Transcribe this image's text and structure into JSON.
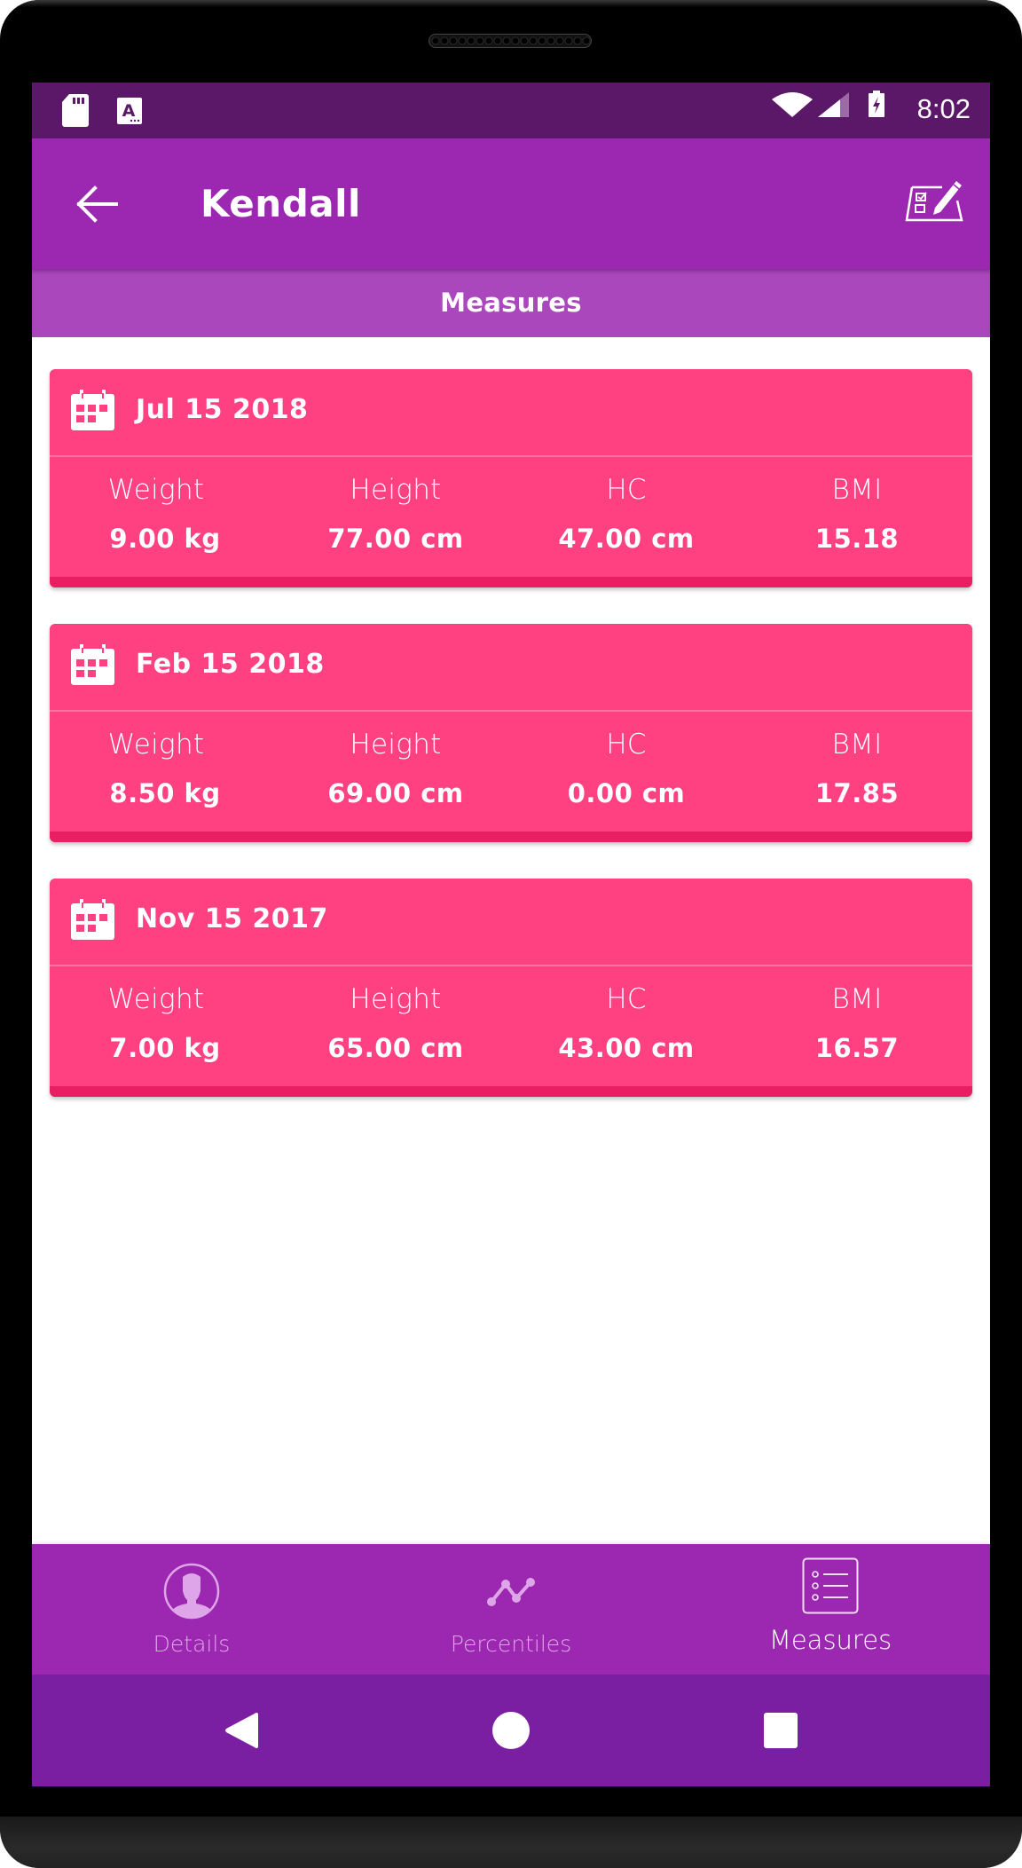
{
  "status_bar": {
    "time": "8:02",
    "left_icons": [
      "sd-card-icon",
      "a-notification-icon"
    ],
    "right_icons": [
      "wifi-icon",
      "cell-signal-icon",
      "battery-charging-icon"
    ]
  },
  "app_bar": {
    "title": "Kendall",
    "back_icon": "arrow-back-icon",
    "action_icon": "edit-checklist-icon"
  },
  "tab_bar": {
    "active_tab": "Measures"
  },
  "colors": {
    "status_bar": "#5c1868",
    "app_bar": "#9c27b0",
    "tab_bar": "#ab47bc",
    "card": "#ff4081",
    "card_border": "#e91e63",
    "system_nav": "#7b1fa2",
    "nav_inactive": "#dea6e8",
    "nav_active": "#ffffff"
  },
  "measures": [
    {
      "date": "Jul 15 2018",
      "stats": [
        {
          "label": "Weight",
          "value": "9.00 kg"
        },
        {
          "label": "Height",
          "value": "77.00 cm"
        },
        {
          "label": "HC",
          "value": "47.00 cm"
        },
        {
          "label": "BMI",
          "value": "15.18"
        }
      ]
    },
    {
      "date": "Feb 15 2018",
      "stats": [
        {
          "label": "Weight",
          "value": "8.50 kg"
        },
        {
          "label": "Height",
          "value": "69.00 cm"
        },
        {
          "label": "HC",
          "value": "0.00 cm"
        },
        {
          "label": "BMI",
          "value": "17.85"
        }
      ]
    },
    {
      "date": "Nov 15 2017",
      "stats": [
        {
          "label": "Weight",
          "value": "7.00 kg"
        },
        {
          "label": "Height",
          "value": "65.00 cm"
        },
        {
          "label": "HC",
          "value": "43.00 cm"
        },
        {
          "label": "BMI",
          "value": "16.57"
        }
      ]
    }
  ],
  "bottom_nav": {
    "items": [
      {
        "label": "Details",
        "icon": "person-circle-icon",
        "active": false
      },
      {
        "label": "Percentiles",
        "icon": "line-chart-icon",
        "active": false
      },
      {
        "label": "Measures",
        "icon": "list-icon",
        "active": true
      }
    ]
  },
  "system_nav": {
    "buttons": [
      "back",
      "home",
      "recents"
    ]
  }
}
